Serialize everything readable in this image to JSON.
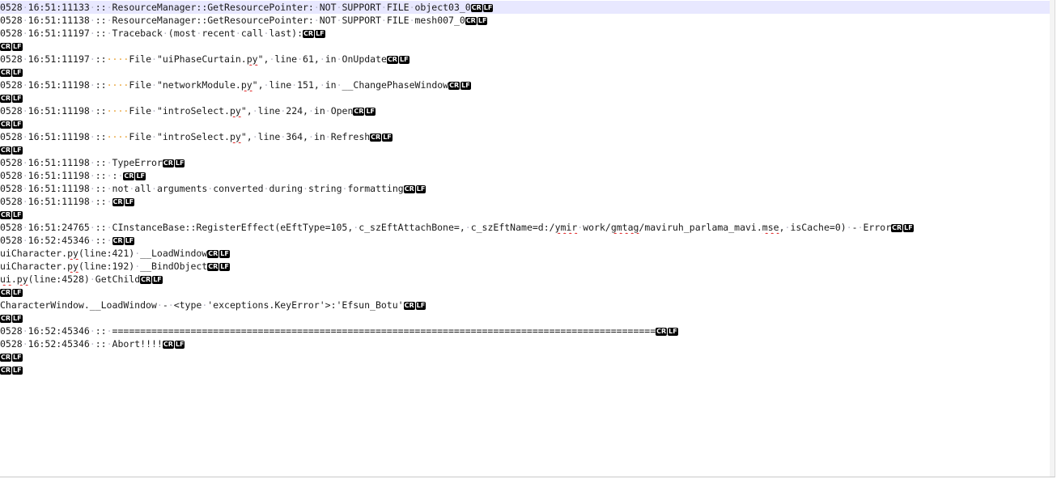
{
  "eol": [
    "CR",
    "LF"
  ],
  "lines": [
    {
      "current": true,
      "segments": [
        {
          "t": "0528"
        },
        {
          "s": 1
        },
        {
          "t": "16:51:11133"
        },
        {
          "s": 1
        },
        {
          "t": "::"
        },
        {
          "s": 1
        },
        {
          "t": "ResourceManager::GetResourcePointer:"
        },
        {
          "s": 1
        },
        {
          "t": "NOT"
        },
        {
          "s": 1
        },
        {
          "t": "SUPPORT"
        },
        {
          "s": 1
        },
        {
          "t": "FILE"
        },
        {
          "s": 1
        },
        {
          "t": "object03_0"
        }
      ]
    },
    {
      "segments": [
        {
          "t": "0528"
        },
        {
          "s": 1
        },
        {
          "t": "16:51:11138"
        },
        {
          "s": 1
        },
        {
          "t": "::"
        },
        {
          "s": 1
        },
        {
          "t": "ResourceManager::GetResourcePointer:"
        },
        {
          "s": 1
        },
        {
          "t": "NOT"
        },
        {
          "s": 1
        },
        {
          "t": "SUPPORT"
        },
        {
          "s": 1
        },
        {
          "t": "FILE"
        },
        {
          "s": 1
        },
        {
          "t": "mesh007_0"
        }
      ]
    },
    {
      "segments": [
        {
          "t": "0528"
        },
        {
          "s": 1
        },
        {
          "t": "16:51:11197"
        },
        {
          "s": 1
        },
        {
          "t": "::"
        },
        {
          "s": 1
        },
        {
          "t": "Traceback"
        },
        {
          "s": 1
        },
        {
          "t": "(most"
        },
        {
          "s": 1
        },
        {
          "t": "recent"
        },
        {
          "s": 1
        },
        {
          "t": "call"
        },
        {
          "s": 1
        },
        {
          "t": "last):"
        }
      ]
    },
    {
      "segments": []
    },
    {
      "segments": [
        {
          "t": "0528"
        },
        {
          "s": 1
        },
        {
          "t": "16:51:11197"
        },
        {
          "s": 1
        },
        {
          "t": "::"
        },
        {
          "tab": 1
        },
        {
          "t": "File"
        },
        {
          "s": 1
        },
        {
          "t": "\"uiPhaseCurtain."
        },
        {
          "e": "py"
        },
        {
          "t": "\","
        },
        {
          "s": 1
        },
        {
          "t": "line"
        },
        {
          "s": 1
        },
        {
          "t": "61,"
        },
        {
          "s": 1
        },
        {
          "t": "in"
        },
        {
          "s": 1
        },
        {
          "t": "OnUpdate"
        }
      ]
    },
    {
      "segments": []
    },
    {
      "segments": [
        {
          "t": "0528"
        },
        {
          "s": 1
        },
        {
          "t": "16:51:11198"
        },
        {
          "s": 1
        },
        {
          "t": "::"
        },
        {
          "tab": 1
        },
        {
          "t": "File"
        },
        {
          "s": 1
        },
        {
          "t": "\"networkModule."
        },
        {
          "e": "py"
        },
        {
          "t": "\","
        },
        {
          "s": 1
        },
        {
          "t": "line"
        },
        {
          "s": 1
        },
        {
          "t": "151,"
        },
        {
          "s": 1
        },
        {
          "t": "in"
        },
        {
          "s": 1
        },
        {
          "t": "__ChangePhaseWindow"
        }
      ]
    },
    {
      "segments": []
    },
    {
      "segments": [
        {
          "t": "0528"
        },
        {
          "s": 1
        },
        {
          "t": "16:51:11198"
        },
        {
          "s": 1
        },
        {
          "t": "::"
        },
        {
          "tab": 1
        },
        {
          "t": "File"
        },
        {
          "s": 1
        },
        {
          "t": "\"introSelect."
        },
        {
          "e": "py"
        },
        {
          "t": "\","
        },
        {
          "s": 1
        },
        {
          "t": "line"
        },
        {
          "s": 1
        },
        {
          "t": "224,"
        },
        {
          "s": 1
        },
        {
          "t": "in"
        },
        {
          "s": 1
        },
        {
          "t": "Open"
        }
      ]
    },
    {
      "segments": []
    },
    {
      "segments": [
        {
          "t": "0528"
        },
        {
          "s": 1
        },
        {
          "t": "16:51:11198"
        },
        {
          "s": 1
        },
        {
          "t": "::"
        },
        {
          "tab": 1
        },
        {
          "t": "File"
        },
        {
          "s": 1
        },
        {
          "t": "\"introSelect."
        },
        {
          "e": "py"
        },
        {
          "t": "\","
        },
        {
          "s": 1
        },
        {
          "t": "line"
        },
        {
          "s": 1
        },
        {
          "t": "364,"
        },
        {
          "s": 1
        },
        {
          "t": "in"
        },
        {
          "s": 1
        },
        {
          "t": "Refresh"
        }
      ]
    },
    {
      "segments": []
    },
    {
      "segments": [
        {
          "t": "0528"
        },
        {
          "s": 1
        },
        {
          "t": "16:51:11198"
        },
        {
          "s": 1
        },
        {
          "t": "::"
        },
        {
          "s": 1
        },
        {
          "t": "TypeError"
        }
      ]
    },
    {
      "segments": [
        {
          "t": "0528"
        },
        {
          "s": 1
        },
        {
          "t": "16:51:11198"
        },
        {
          "s": 1
        },
        {
          "t": "::"
        },
        {
          "s": 1
        },
        {
          "t": ":"
        },
        {
          "s": 1
        }
      ]
    },
    {
      "segments": [
        {
          "t": "0528"
        },
        {
          "s": 1
        },
        {
          "t": "16:51:11198"
        },
        {
          "s": 1
        },
        {
          "t": "::"
        },
        {
          "s": 1
        },
        {
          "t": "not"
        },
        {
          "s": 1
        },
        {
          "t": "all"
        },
        {
          "s": 1
        },
        {
          "t": "arguments"
        },
        {
          "s": 1
        },
        {
          "t": "converted"
        },
        {
          "s": 1
        },
        {
          "t": "during"
        },
        {
          "s": 1
        },
        {
          "t": "string"
        },
        {
          "s": 1
        },
        {
          "t": "formatting"
        }
      ]
    },
    {
      "segments": [
        {
          "t": "0528"
        },
        {
          "s": 1
        },
        {
          "t": "16:51:11198"
        },
        {
          "s": 1
        },
        {
          "t": "::"
        },
        {
          "s": 1
        }
      ]
    },
    {
      "segments": []
    },
    {
      "segments": [
        {
          "t": "0528"
        },
        {
          "s": 1
        },
        {
          "t": "16:51:24765"
        },
        {
          "s": 1
        },
        {
          "t": "::"
        },
        {
          "s": 1
        },
        {
          "t": "CInstanceBase::RegisterEffect(eEftType=105,"
        },
        {
          "s": 1
        },
        {
          "t": "c_szEftAttachBone=,"
        },
        {
          "s": 1
        },
        {
          "t": "c_szEftName=d:/"
        },
        {
          "e": "ymir"
        },
        {
          "s": 1
        },
        {
          "t": "work/"
        },
        {
          "e": "gmtag"
        },
        {
          "t": "/maviruh_parlama_mavi."
        },
        {
          "e": "mse"
        },
        {
          "t": ","
        },
        {
          "s": 1
        },
        {
          "t": "isCache=0)"
        },
        {
          "s": 1
        },
        {
          "t": "-"
        },
        {
          "s": 1
        },
        {
          "t": "Error"
        }
      ]
    },
    {
      "segments": [
        {
          "t": "0528"
        },
        {
          "s": 1
        },
        {
          "t": "16:52:45346"
        },
        {
          "s": 1
        },
        {
          "t": "::"
        },
        {
          "s": 1
        }
      ]
    },
    {
      "segments": [
        {
          "t": "uiCharacter."
        },
        {
          "e": "py"
        },
        {
          "t": "(line:421)"
        },
        {
          "s": 1
        },
        {
          "t": "__LoadWindow"
        }
      ]
    },
    {
      "segments": [
        {
          "t": "uiCharacter."
        },
        {
          "e": "py"
        },
        {
          "t": "(line:192)"
        },
        {
          "s": 1
        },
        {
          "t": "__BindObject"
        }
      ]
    },
    {
      "segments": [
        {
          "e": "ui"
        },
        {
          "t": "."
        },
        {
          "e": "py"
        },
        {
          "t": "(line:4528)"
        },
        {
          "s": 1
        },
        {
          "t": "GetChild"
        }
      ]
    },
    {
      "segments": []
    },
    {
      "segments": [
        {
          "t": "CharacterWindow.__LoadWindow"
        },
        {
          "s": 1
        },
        {
          "t": "-"
        },
        {
          "s": 1
        },
        {
          "t": "<type"
        },
        {
          "s": 1
        },
        {
          "t": "'exceptions.KeyError'>:'Efsun_Botu'"
        }
      ]
    },
    {
      "segments": []
    },
    {
      "segments": [
        {
          "t": "0528"
        },
        {
          "s": 1
        },
        {
          "t": "16:52:45346"
        },
        {
          "s": 1
        },
        {
          "t": "::"
        },
        {
          "s": 1
        },
        {
          "t": "================================================================================================="
        }
      ]
    },
    {
      "segments": [
        {
          "t": "0528"
        },
        {
          "s": 1
        },
        {
          "t": "16:52:45346"
        },
        {
          "s": 1
        },
        {
          "t": "::"
        },
        {
          "s": 1
        },
        {
          "t": "Abort!!!!"
        }
      ]
    },
    {
      "segments": []
    },
    {
      "segments": []
    }
  ]
}
